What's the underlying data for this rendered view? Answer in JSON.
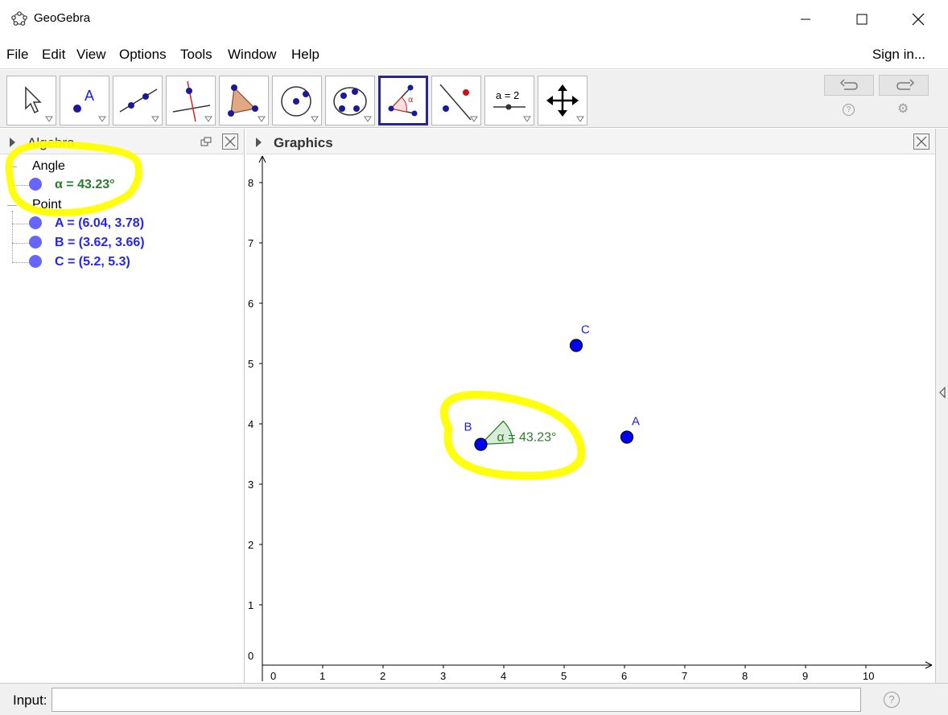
{
  "window": {
    "title": "GeoGebra"
  },
  "menu": {
    "items": [
      "File",
      "Edit",
      "View",
      "Options",
      "Tools",
      "Window",
      "Help"
    ],
    "sign_in": "Sign in..."
  },
  "toolbar": {
    "tools": [
      {
        "name": "move-tool-icon"
      },
      {
        "name": "point-tool-icon",
        "label": "A"
      },
      {
        "name": "line-tool-icon"
      },
      {
        "name": "perpendicular-line-tool-icon"
      },
      {
        "name": "polygon-tool-icon"
      },
      {
        "name": "circle-tool-icon"
      },
      {
        "name": "conic-tool-icon"
      },
      {
        "name": "angle-tool-icon",
        "label": "α",
        "active": true
      },
      {
        "name": "reflect-tool-icon"
      },
      {
        "name": "slider-tool-icon",
        "label": "a = 2"
      },
      {
        "name": "move-graphics-view-tool-icon"
      }
    ],
    "undo_icon": "undo-icon",
    "redo_icon": "redo-icon",
    "help_icon": "?",
    "settings_icon": "⚙"
  },
  "algebra": {
    "title": "Algebra",
    "groups": [
      {
        "heading": "Angle",
        "items": [
          {
            "text": "α = 43.23°",
            "color": "#2a7d2a"
          }
        ]
      },
      {
        "heading": "Point",
        "items": [
          {
            "text": "A = (6.04, 3.78)",
            "color": "#2626e6"
          },
          {
            "text": "B = (3.62, 3.66)",
            "color": "#2626e6"
          },
          {
            "text": "C = (5.2, 5.3)",
            "color": "#2626e6"
          }
        ]
      }
    ]
  },
  "graphics": {
    "title": "Graphics",
    "x_ticks": [
      "0",
      "1",
      "2",
      "3",
      "4",
      "5",
      "6",
      "7",
      "8",
      "9",
      "10"
    ],
    "y_ticks": [
      "0",
      "1",
      "2",
      "3",
      "4",
      "5",
      "6",
      "7",
      "8"
    ],
    "points": [
      {
        "label": "A",
        "x": 6.04,
        "y": 3.78
      },
      {
        "label": "B",
        "x": 3.62,
        "y": 3.66
      },
      {
        "label": "C",
        "x": 5.2,
        "y": 5.3
      }
    ],
    "angle_label": "α = 43.23°",
    "point_color": "#0000ff",
    "label_color": "#2222dd",
    "angle_color": "#2a7d2a",
    "highlight_color": "#ffff00"
  },
  "input": {
    "label": "Input:",
    "value": "",
    "help": "?"
  }
}
